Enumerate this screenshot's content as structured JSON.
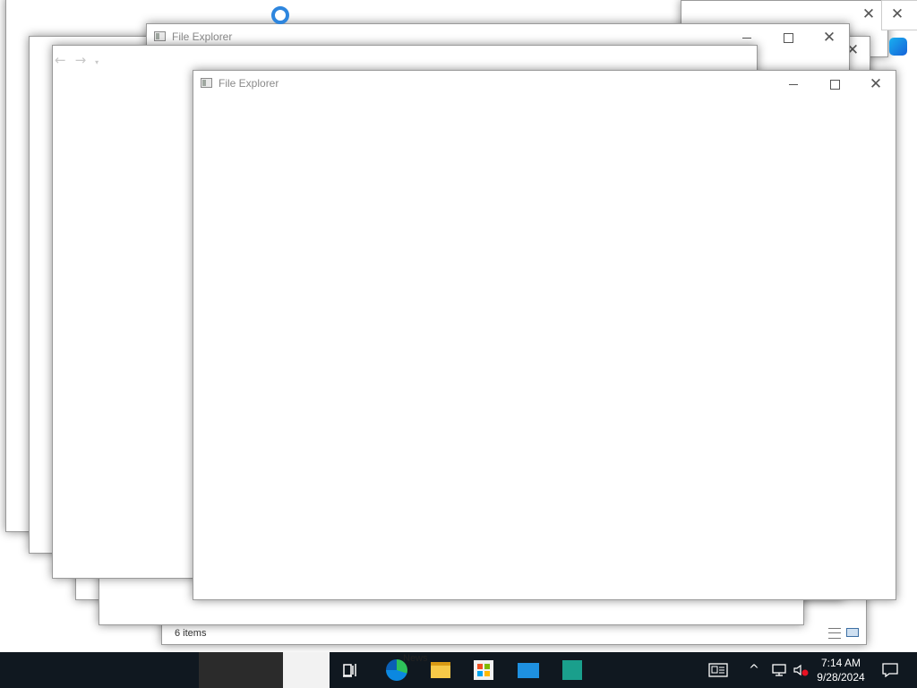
{
  "windows": {
    "front_title": "File Explorer",
    "second_title": "File Explorer",
    "back_status": "6 items"
  },
  "taskbar": {
    "news_label": "News",
    "clock_time": "7:14 AM",
    "clock_date": "9/28/2024",
    "icons": [
      "task-view-icon",
      "edge-icon",
      "file-explorer-icon",
      "store-icon",
      "mail-icon",
      "app-icon"
    ]
  },
  "colors": {
    "taskbar_bg": "#101820",
    "accent": "#0078d7"
  }
}
